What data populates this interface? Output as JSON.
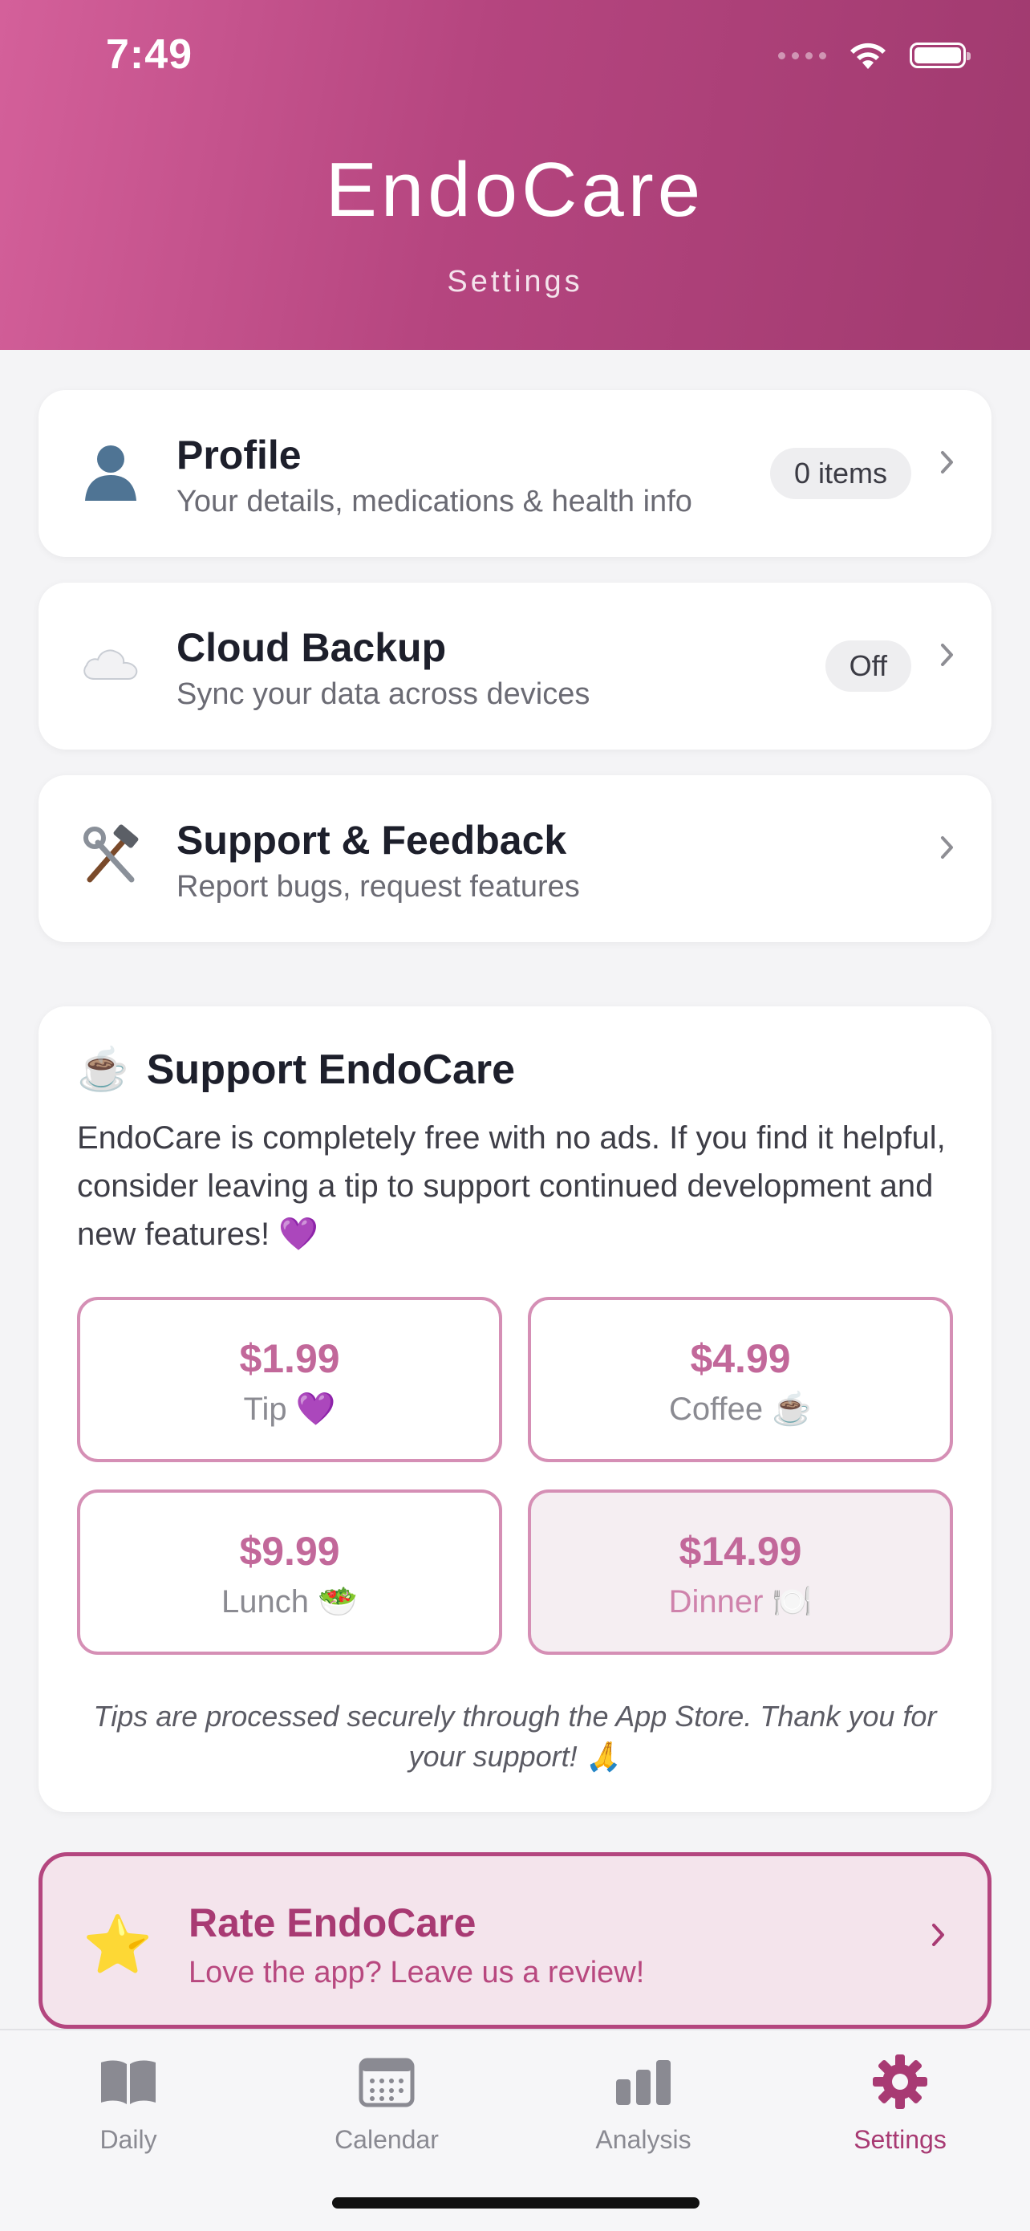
{
  "status_bar": {
    "time": "7:49"
  },
  "header": {
    "title": "EndoCare",
    "subtitle": "Settings"
  },
  "rows": [
    {
      "title": "Profile",
      "subtitle": "Your details, medications & health info",
      "badge": "0 items",
      "icon": "person-silhouette-icon"
    },
    {
      "title": "Cloud Backup",
      "subtitle": "Sync your data across devices",
      "badge": "Off",
      "icon": "cloud-icon"
    },
    {
      "title": "Support & Feedback",
      "subtitle": "Report bugs, request features",
      "icon": "hammer-wrench-icon"
    }
  ],
  "support": {
    "icon": "☕",
    "title": "Support EndoCare",
    "description": "EndoCare is completely free with no ads. If you find it helpful, consider leaving a tip to support continued development and new features! 💜",
    "tips": [
      {
        "price": "$1.99",
        "label": "Tip 💜"
      },
      {
        "price": "$4.99",
        "label": "Coffee ☕"
      },
      {
        "price": "$9.99",
        "label": "Lunch 🥗"
      },
      {
        "price": "$14.99",
        "label": "Dinner 🍽️"
      }
    ],
    "note": "Tips are processed securely through the App Store. Thank you for your support! 🙏"
  },
  "rate": {
    "icon": "⭐",
    "title": "Rate EndoCare",
    "subtitle": "Love the app? Leave us a review!"
  },
  "tabs": [
    {
      "label": "Daily",
      "icon": "book-icon"
    },
    {
      "label": "Calendar",
      "icon": "calendar-icon"
    },
    {
      "label": "Analysis",
      "icon": "bar-chart-icon"
    },
    {
      "label": "Settings",
      "icon": "gear-icon",
      "active": true
    }
  ],
  "colors": {
    "accent": "#a83a73",
    "header_start": "#d4609a",
    "header_end": "#a03a6f",
    "tip_border": "#d58fb5"
  }
}
